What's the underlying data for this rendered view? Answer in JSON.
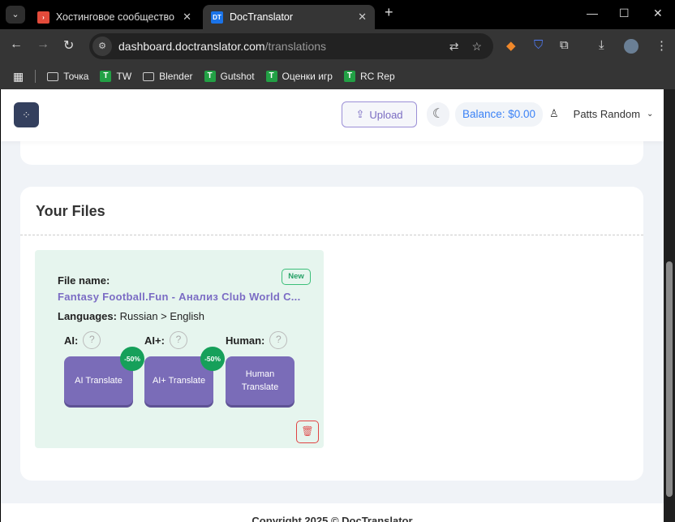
{
  "browser": {
    "tabs": [
      {
        "title": "Хостинговое сообщество «Tim",
        "favicon": "›",
        "color": "#e34b3b"
      },
      {
        "title": "DocTranslator",
        "favicon": "DT",
        "color": "#1a73e8"
      }
    ],
    "url_host": "dashboard.doctranslator.com",
    "url_path": "/translations",
    "bookmarks": [
      {
        "label": "Точка",
        "icon": "folder-icon"
      },
      {
        "label": "TW",
        "icon": "green-bookmark-icon"
      },
      {
        "label": "Blender",
        "icon": "folder-icon"
      },
      {
        "label": "Gutshot",
        "icon": "green-bookmark-icon"
      },
      {
        "label": "Оценки игр",
        "icon": "green-bookmark-icon"
      },
      {
        "label": "RC Rep",
        "icon": "green-bookmark-icon"
      }
    ]
  },
  "header": {
    "upload": "Upload",
    "balance": "Balance: $0.00",
    "user": "Patts Random"
  },
  "files": {
    "title": "Your Files",
    "items": [
      {
        "badge": "New",
        "file_label": "File name:",
        "file_name": "Fantasy Football.Fun - Анализ Club World C...",
        "lang_label": "Languages:",
        "languages": "Russian > English",
        "options": [
          {
            "label": "AI:",
            "button": "AI Translate",
            "discount": "-50%"
          },
          {
            "label": "AI+:",
            "button": "AI+ Translate",
            "discount": "-50%"
          },
          {
            "label": "Human:",
            "button": "Human Translate",
            "discount": ""
          }
        ]
      }
    ]
  },
  "footer": {
    "copyright": "Copyright 2025 © DocTranslator"
  },
  "colors": {
    "accent": "#7a6cb8",
    "balance": "#3b82f6",
    "discount": "#16a05a",
    "card": "#e6f5ee"
  }
}
